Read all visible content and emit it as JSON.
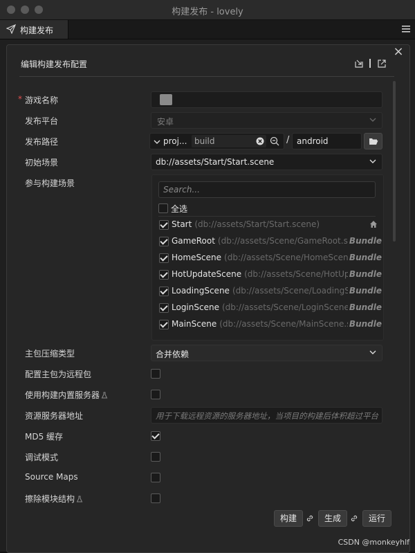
{
  "window": {
    "title": "构建发布 - lovely"
  },
  "tabs": [
    {
      "label": "构建发布",
      "icon": "send-icon"
    }
  ],
  "dialog": {
    "title": "编辑构建发布配置",
    "import_icon": "import-icon",
    "export_icon": "export-icon",
    "close": "×"
  },
  "form": {
    "game_name": {
      "label": "游戏名称",
      "required_mark": "*",
      "value": ""
    },
    "platform": {
      "label": "发布平台",
      "value": "安卓"
    },
    "build_path": {
      "label": "发布路径",
      "prefix": "proj...",
      "value": "build",
      "separator": "/",
      "subdir": "android"
    },
    "start_scene": {
      "label": "初始场景",
      "value": "db://assets/Start/Start.scene"
    },
    "included_scenes": {
      "label": "参与构建场景",
      "search_placeholder": "Search...",
      "select_all_label": "全选",
      "select_all_checked": false,
      "scenes": [
        {
          "name": "Start",
          "path": "(db://assets/Start/Start.scene)",
          "bundle": "",
          "checked": true,
          "home": true
        },
        {
          "name": "GameRoot",
          "path": "(db://assets/Scene/GameRoot.scene)",
          "bundle": "Bundle",
          "checked": true,
          "home": false
        },
        {
          "name": "HomeScene",
          "path": "(db://assets/Scene/HomeScene.scene)",
          "bundle": "Bundle",
          "checked": true,
          "home": false
        },
        {
          "name": "HotUpdateScene",
          "path": "(db://assets/Scene/HotUpdateScene.scene)",
          "bundle": "Bundle",
          "checked": true,
          "home": false
        },
        {
          "name": "LoadingScene",
          "path": "(db://assets/Scene/LoadingScene.scene)",
          "bundle": "Bundle",
          "checked": true,
          "home": false
        },
        {
          "name": "LoginScene",
          "path": "(db://assets/Scene/LoginScene.scene)",
          "bundle": "Bundle",
          "checked": true,
          "home": false
        },
        {
          "name": "MainScene",
          "path": "(db://assets/Scene/MainScene.scene)",
          "bundle": "Bundle",
          "checked": true,
          "home": false
        }
      ]
    },
    "compression": {
      "label": "主包压缩类型",
      "value": "合并依赖"
    },
    "remote_main": {
      "label": "配置主包为远程包",
      "checked": false
    },
    "builtin_server": {
      "label": "使用构建内置服务器",
      "checked": false
    },
    "server_address": {
      "label": "资源服务器地址",
      "placeholder": "用于下载远程资源的服务器地址，当项目的构建后体积超过平台"
    },
    "md5_cache": {
      "label": "MD5 缓存",
      "checked": true
    },
    "debug_mode": {
      "label": "调试模式",
      "checked": false
    },
    "source_maps": {
      "label": "Source Maps",
      "checked": false
    },
    "erase_module": {
      "label": "擦除模块结构",
      "checked": false
    }
  },
  "buttons": {
    "build": "构建",
    "make": "生成",
    "run": "运行"
  },
  "watermark": "CSDN @monkeyhlf"
}
